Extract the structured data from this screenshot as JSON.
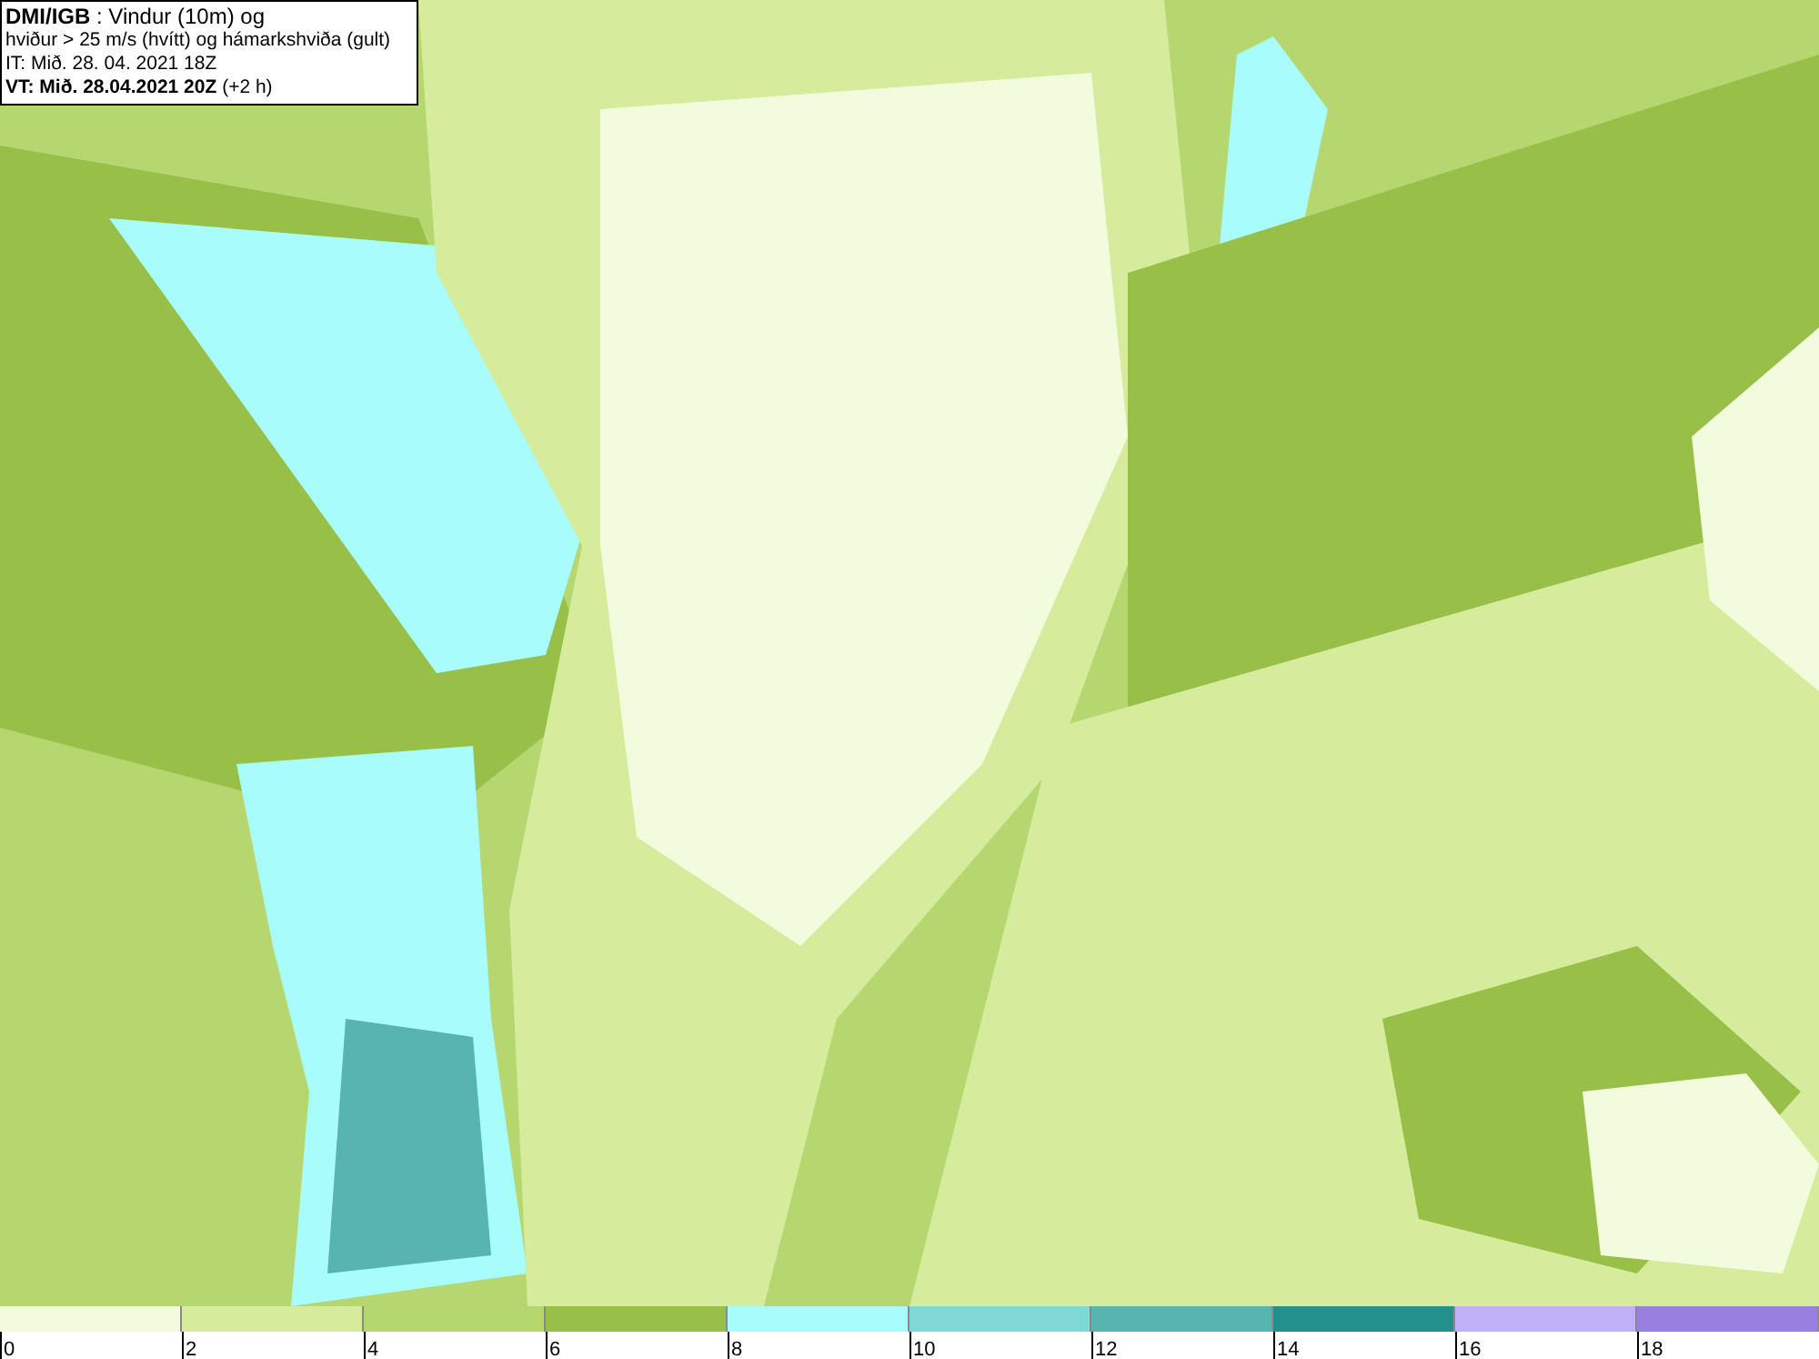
{
  "title_box": {
    "lines": [
      "**DMI/IGB** : Vindur (10m) og",
      "hviður > 25 m/s (hvítt) og hámarkshviða (gult)",
      "IT: Mið. 28. 04. 2021 18Z",
      "**VT: Mið. 28.04.2021 20Z** (+2 h)"
    ]
  },
  "legend": [
    {
      "label": "0",
      "color": "#f2fbdc"
    },
    {
      "label": "2",
      "color": "#d4ec9c"
    },
    {
      "label": "4",
      "color": "#b6d770"
    },
    {
      "label": "6",
      "color": "#98bf48"
    },
    {
      "label": "8",
      "color": "#a8fcfc"
    },
    {
      "label": "10",
      "color": "#80d8d4"
    },
    {
      "label": "12",
      "color": "#58b4b0"
    },
    {
      "label": "14",
      "color": "#24908c"
    },
    {
      "label": "16",
      "color": "#c0b0f8"
    },
    {
      "label": "18",
      "color": "#9880e0"
    }
  ]
}
